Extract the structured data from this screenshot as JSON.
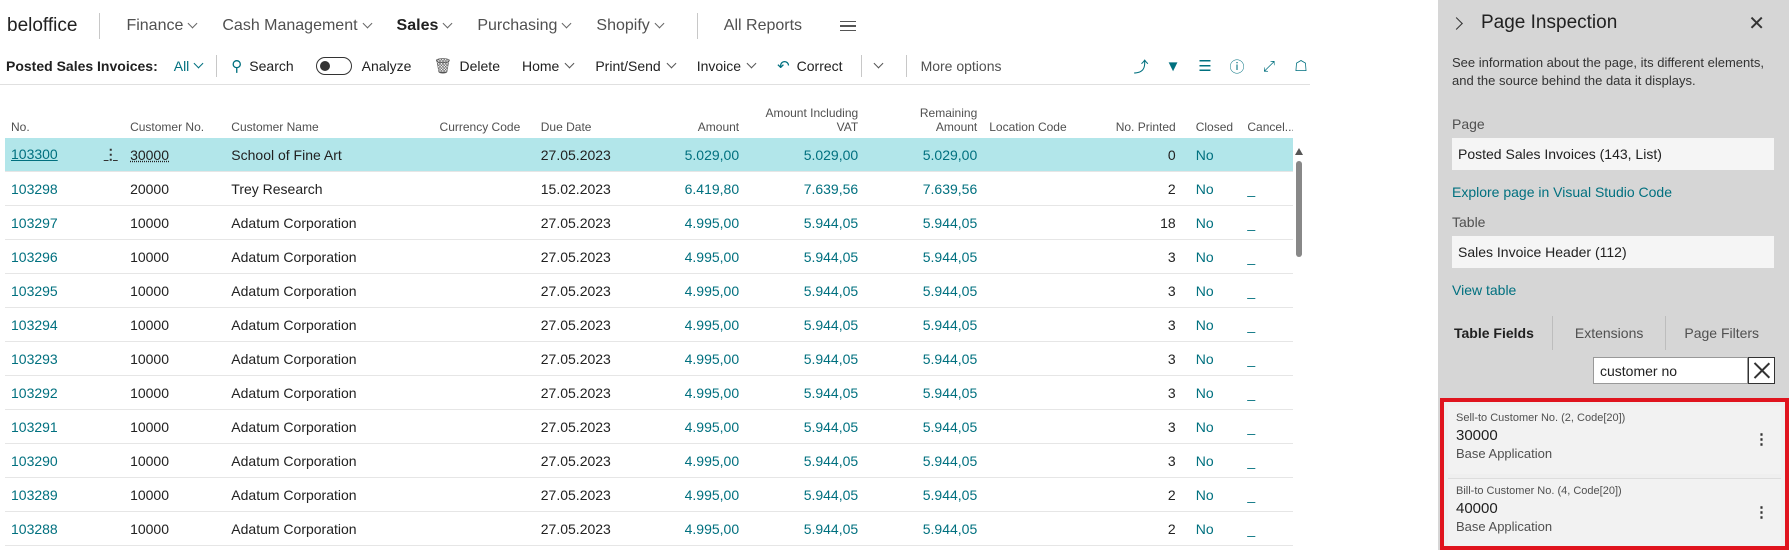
{
  "nav": {
    "brand": "beloffice",
    "items": [
      {
        "label": "Finance",
        "chev": true
      },
      {
        "label": "Cash Management",
        "chev": true
      },
      {
        "label": "Sales",
        "chev": true
      },
      {
        "label": "Purchasing",
        "chev": true
      },
      {
        "label": "Shopify",
        "chev": true
      }
    ],
    "all_reports": "All Reports"
  },
  "actionbar": {
    "title": "Posted Sales Invoices:",
    "filter": "All",
    "search": "Search",
    "analyze": "Analyze",
    "delete": "Delete",
    "home": "Home",
    "print_send": "Print/Send",
    "invoice": "Invoice",
    "correct": "Correct",
    "more_options": "More options"
  },
  "grid": {
    "headers": {
      "no": "No.",
      "customer_no": "Customer No.",
      "customer_name": "Customer Name",
      "currency_code": "Currency Code",
      "due_date": "Due Date",
      "amount": "Amount",
      "amount_vat_1": "Amount Including",
      "amount_vat_2": "VAT",
      "remaining_1": "Remaining",
      "remaining_2": "Amount",
      "location_code": "Location Code",
      "no_printed": "No. Printed",
      "closed": "Closed",
      "cancelled": "Cancel..."
    },
    "rows": [
      {
        "no": "103300",
        "cust": "30000",
        "name": "School of Fine Art",
        "cur": "",
        "due": "27.05.2023",
        "amt": "5.029,00",
        "vat": "5.029,00",
        "rem": "5.029,00",
        "loc": "",
        "printed": "0",
        "closed": "No",
        "cancel": ""
      },
      {
        "no": "103298",
        "cust": "20000",
        "name": "Trey Research",
        "cur": "",
        "due": "15.02.2023",
        "amt": "6.419,80",
        "vat": "7.639,56",
        "rem": "7.639,56",
        "loc": "",
        "printed": "2",
        "closed": "No",
        "cancel": "_"
      },
      {
        "no": "103297",
        "cust": "10000",
        "name": "Adatum Corporation",
        "cur": "",
        "due": "27.05.2023",
        "amt": "4.995,00",
        "vat": "5.944,05",
        "rem": "5.944,05",
        "loc": "",
        "printed": "18",
        "closed": "No",
        "cancel": "_"
      },
      {
        "no": "103296",
        "cust": "10000",
        "name": "Adatum Corporation",
        "cur": "",
        "due": "27.05.2023",
        "amt": "4.995,00",
        "vat": "5.944,05",
        "rem": "5.944,05",
        "loc": "",
        "printed": "3",
        "closed": "No",
        "cancel": "_"
      },
      {
        "no": "103295",
        "cust": "10000",
        "name": "Adatum Corporation",
        "cur": "",
        "due": "27.05.2023",
        "amt": "4.995,00",
        "vat": "5.944,05",
        "rem": "5.944,05",
        "loc": "",
        "printed": "3",
        "closed": "No",
        "cancel": "_"
      },
      {
        "no": "103294",
        "cust": "10000",
        "name": "Adatum Corporation",
        "cur": "",
        "due": "27.05.2023",
        "amt": "4.995,00",
        "vat": "5.944,05",
        "rem": "5.944,05",
        "loc": "",
        "printed": "3",
        "closed": "No",
        "cancel": "_"
      },
      {
        "no": "103293",
        "cust": "10000",
        "name": "Adatum Corporation",
        "cur": "",
        "due": "27.05.2023",
        "amt": "4.995,00",
        "vat": "5.944,05",
        "rem": "5.944,05",
        "loc": "",
        "printed": "3",
        "closed": "No",
        "cancel": "_"
      },
      {
        "no": "103292",
        "cust": "10000",
        "name": "Adatum Corporation",
        "cur": "",
        "due": "27.05.2023",
        "amt": "4.995,00",
        "vat": "5.944,05",
        "rem": "5.944,05",
        "loc": "",
        "printed": "3",
        "closed": "No",
        "cancel": "_"
      },
      {
        "no": "103291",
        "cust": "10000",
        "name": "Adatum Corporation",
        "cur": "",
        "due": "27.05.2023",
        "amt": "4.995,00",
        "vat": "5.944,05",
        "rem": "5.944,05",
        "loc": "",
        "printed": "3",
        "closed": "No",
        "cancel": "_"
      },
      {
        "no": "103290",
        "cust": "10000",
        "name": "Adatum Corporation",
        "cur": "",
        "due": "27.05.2023",
        "amt": "4.995,00",
        "vat": "5.944,05",
        "rem": "5.944,05",
        "loc": "",
        "printed": "3",
        "closed": "No",
        "cancel": "_"
      },
      {
        "no": "103289",
        "cust": "10000",
        "name": "Adatum Corporation",
        "cur": "",
        "due": "27.05.2023",
        "amt": "4.995,00",
        "vat": "5.944,05",
        "rem": "5.944,05",
        "loc": "",
        "printed": "2",
        "closed": "No",
        "cancel": "_"
      },
      {
        "no": "103288",
        "cust": "10000",
        "name": "Adatum Corporation",
        "cur": "",
        "due": "27.05.2023",
        "amt": "4.995,00",
        "vat": "5.944,05",
        "rem": "5.944,05",
        "loc": "",
        "printed": "2",
        "closed": "No",
        "cancel": "_"
      }
    ]
  },
  "panel": {
    "title": "Page Inspection",
    "description": "See information about the page, its different elements, and the source behind the data it displays.",
    "page_label": "Page",
    "page_value": "Posted Sales Invoices (143, List)",
    "explore_link": "Explore page in Visual Studio Code",
    "table_label": "Table",
    "table_value": "Sales Invoice Header (112)",
    "view_table_link": "View table",
    "tabs": [
      "Table Fields",
      "Extensions",
      "Page Filters"
    ],
    "search_value": "customer no",
    "results": [
      {
        "name": "Sell-to Customer No. (2, Code[20])",
        "value": "30000",
        "source": "Base Application"
      },
      {
        "name": "Bill-to Customer No. (4, Code[20])",
        "value": "40000",
        "source": "Base Application"
      }
    ]
  },
  "colors": {
    "accent": "#00707f",
    "selected_row": "#b2e6ea",
    "panel_bg": "#d6d6d6",
    "highlight_border": "#e0141e"
  }
}
